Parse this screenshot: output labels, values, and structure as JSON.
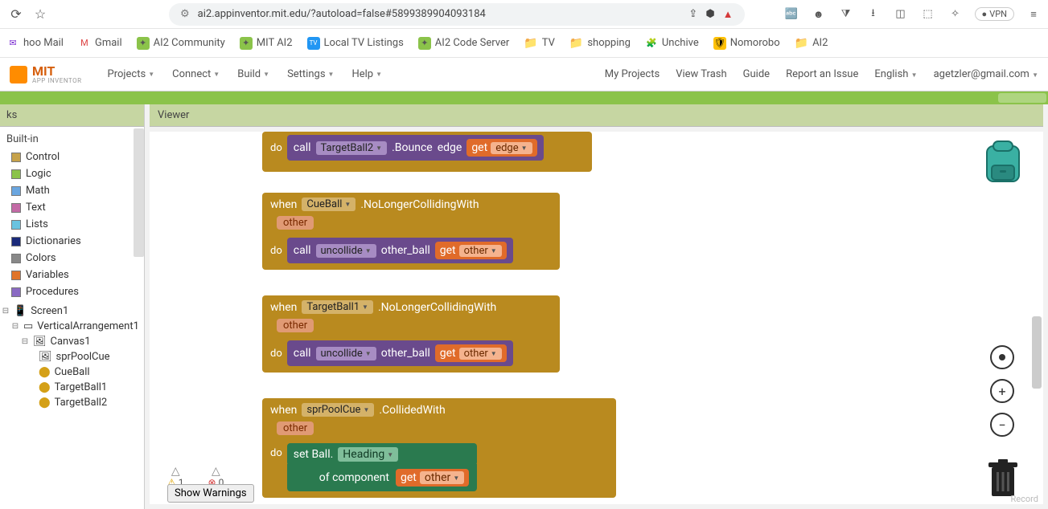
{
  "browser": {
    "url": "ai2.appinventor.mit.edu/?autoload=false#5899389904093184",
    "vpn": "VPN"
  },
  "bookmarks": [
    {
      "label": "hoo Mail"
    },
    {
      "label": "Gmail"
    },
    {
      "label": "AI2 Community"
    },
    {
      "label": "MIT AI2"
    },
    {
      "label": "Local TV Listings"
    },
    {
      "label": "AI2 Code Server"
    },
    {
      "label": "TV"
    },
    {
      "label": "shopping"
    },
    {
      "label": "Unchive"
    },
    {
      "label": "Nomorobo"
    },
    {
      "label": "AI2"
    }
  ],
  "ai2": {
    "brand": "MIT",
    "brandSub": "APP INVENTOR",
    "menu": [
      "Projects",
      "Connect",
      "Build",
      "Settings",
      "Help"
    ],
    "right": [
      "My Projects",
      "View Trash",
      "Guide",
      "Report an Issue",
      "English",
      "agetzler@gmail.com"
    ]
  },
  "panel": {
    "header": "ks",
    "viewerHeader": "Viewer",
    "builtin": "Built-in",
    "drawers": [
      {
        "label": "Control",
        "color": "#c6a24a"
      },
      {
        "label": "Logic",
        "color": "#8bc34a"
      },
      {
        "label": "Math",
        "color": "#6aa6e0"
      },
      {
        "label": "Text",
        "color": "#c36aa6"
      },
      {
        "label": "Lists",
        "color": "#6ac3e0"
      },
      {
        "label": "Dictionaries",
        "color": "#1a2a7a"
      },
      {
        "label": "Colors",
        "color": "#888"
      },
      {
        "label": "Variables",
        "color": "#e0742a"
      },
      {
        "label": "Procedures",
        "color": "#8a6ac3"
      }
    ],
    "components": {
      "root": "Screen1",
      "va": "VerticalArrangement1",
      "canvas": "Canvas1",
      "sprites": [
        "sprPoolCue",
        "CueBall",
        "TargetBall1",
        "TargetBall2"
      ]
    }
  },
  "blocks": {
    "b1": {
      "do": "do",
      "call": "call",
      "target": "TargetBall2",
      "method": ".Bounce",
      "arg": "edge",
      "get": "get",
      "var": "edge"
    },
    "b2": {
      "when": "when",
      "comp": "CueBall",
      "event": ".NoLongerCollidingWith",
      "param": "other",
      "do": "do",
      "call": "call",
      "proc": "uncollide",
      "arg": "other_ball",
      "get": "get",
      "var": "other"
    },
    "b3": {
      "when": "when",
      "comp": "TargetBall1",
      "event": ".NoLongerCollidingWith",
      "param": "other",
      "do": "do",
      "call": "call",
      "proc": "uncollide",
      "arg": "other_ball",
      "get": "get",
      "var": "other"
    },
    "b4": {
      "when": "when",
      "comp": "sprPoolCue",
      "event": ".CollidedWith",
      "param": "other",
      "do": "do",
      "set": "set Ball.",
      "prop": "Heading",
      "ofcomp": "of component",
      "get": "get",
      "var": "other"
    }
  },
  "warnings": {
    "warn": "1",
    "err": "0",
    "btn": "Show Warnings"
  },
  "record": "Record"
}
